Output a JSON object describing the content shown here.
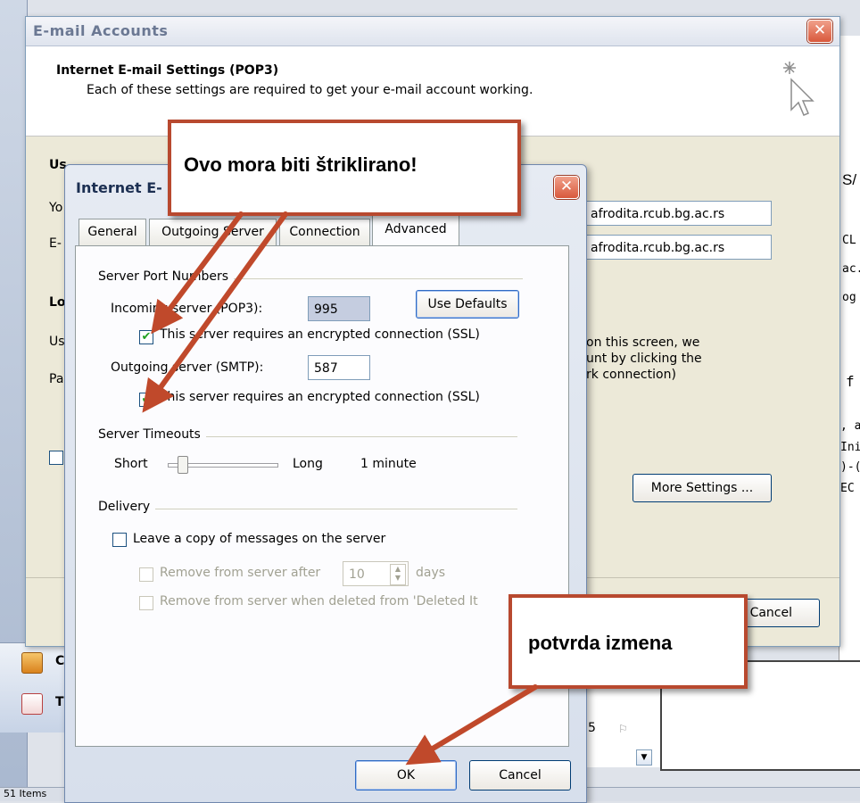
{
  "background": {
    "right_snippets": [
      "S/",
      "CL",
      "ac.",
      "og",
      "f",
      ", a",
      "Ini",
      ")-(",
      "EC"
    ],
    "status_text": "51 Items",
    "list_value": "5",
    "nav_items": [
      "C",
      "T"
    ]
  },
  "outer_dialog": {
    "title": "E-mail Accounts",
    "header_title": "Internet E-mail Settings (POP3)",
    "header_subtitle": "Each of these settings are required to get your e-mail account working.",
    "section_fragment_user": "Us",
    "left_fragments": [
      "Yo",
      "E-",
      "Lo",
      "Us",
      "Pa"
    ],
    "incoming_server_value": "afrodita.rcub.bg.ac.rs",
    "outgoing_server_value": "afrodita.rcub.bg.ac.rs",
    "test_text_lines": [
      "on this screen, we",
      "unt by clicking the",
      "rk connection)"
    ],
    "more_settings_label": "More Settings ...",
    "cancel_label": "Cancel",
    "colors": {
      "close_button": "#d9583c",
      "header_bg": "#ffffff"
    }
  },
  "inner_dialog": {
    "title": "Internet E-",
    "tabs": [
      {
        "label": "General",
        "active": false
      },
      {
        "label": "Outgoing Server",
        "active": false
      },
      {
        "label": "Connection",
        "active": false
      },
      {
        "label": "Advanced",
        "active": true
      }
    ],
    "server_ports": {
      "group_label": "Server Port Numbers",
      "incoming_label": "Incoming server (POP3):",
      "incoming_value": "995",
      "use_defaults_label": "Use Defaults",
      "incoming_ssl_label": "This server requires an encrypted connection (SSL)",
      "incoming_ssl_checked": true,
      "outgoing_label": "Outgoing server (SMTP):",
      "outgoing_value": "587",
      "outgoing_ssl_label": "This server requires an encrypted connection (SSL)",
      "outgoing_ssl_checked": true
    },
    "timeouts": {
      "group_label": "Server Timeouts",
      "short_label": "Short",
      "long_label": "Long",
      "value_label": "1 minute",
      "slider_level": 0.1
    },
    "delivery": {
      "group_label": "Delivery",
      "leave_copy_label": "Leave a copy of messages on the server",
      "leave_copy_checked": false,
      "remove_after_label": "Remove from server after",
      "remove_after_value": "10",
      "days_label": "days",
      "remove_deleted_label": "Remove from server when deleted from 'Deleted It"
    },
    "ok_label": "OK",
    "cancel_label": "Cancel"
  },
  "callouts": {
    "ssl_note": "Ovo mora biti štriklirano!",
    "confirm_note": "potvrda izmena",
    "colors": {
      "border": "#b8492f",
      "arrow": "#c0492b"
    }
  }
}
